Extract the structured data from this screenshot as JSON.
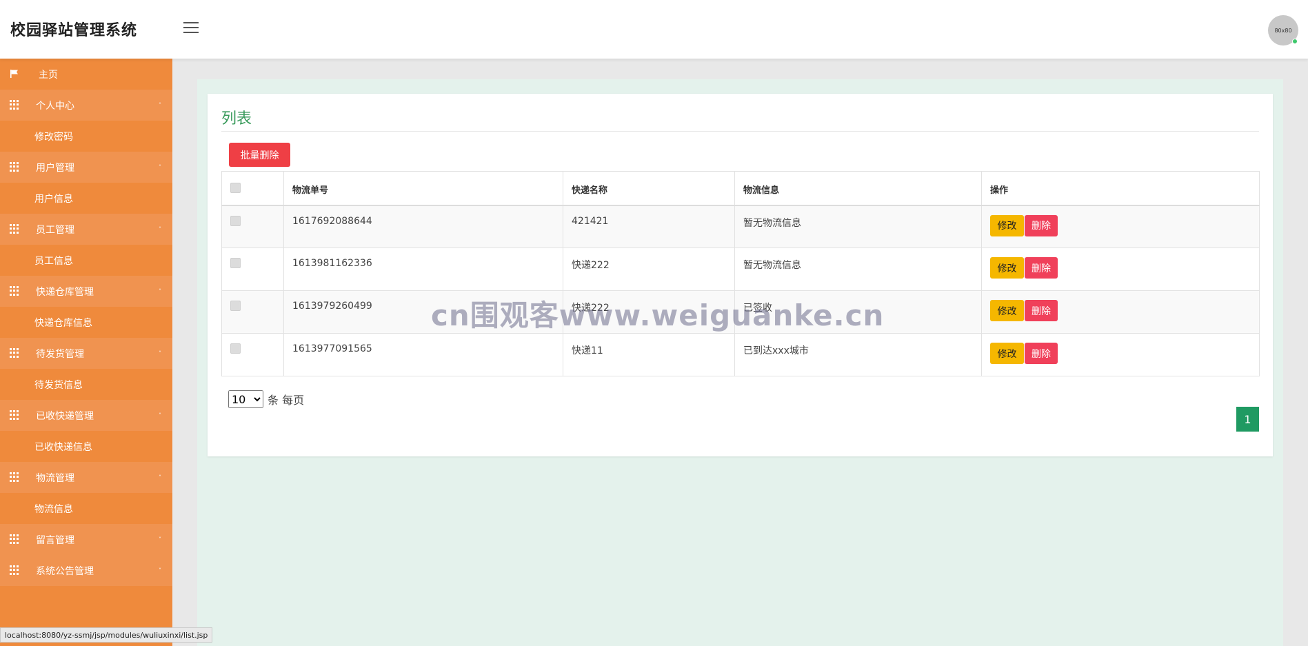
{
  "app": {
    "title": "校园驿站管理系统",
    "avatar_text": "80x80"
  },
  "sidebar": {
    "items": [
      {
        "label": "主页",
        "type": "home",
        "icon": "flag-icon"
      },
      {
        "label": "个人中心",
        "type": "group",
        "caret": "up"
      },
      {
        "label": "修改密码",
        "type": "sub"
      },
      {
        "label": "用户管理",
        "type": "group",
        "caret": "up"
      },
      {
        "label": "用户信息",
        "type": "sub"
      },
      {
        "label": "员工管理",
        "type": "group",
        "caret": "up"
      },
      {
        "label": "员工信息",
        "type": "sub"
      },
      {
        "label": "快递仓库管理",
        "type": "group",
        "caret": "up"
      },
      {
        "label": "快递仓库信息",
        "type": "sub"
      },
      {
        "label": "待发货管理",
        "type": "group",
        "caret": "up"
      },
      {
        "label": "待发货信息",
        "type": "sub"
      },
      {
        "label": "已收快递管理",
        "type": "group",
        "caret": "up"
      },
      {
        "label": "已收快递信息",
        "type": "sub"
      },
      {
        "label": "物流管理",
        "type": "group",
        "caret": "up"
      },
      {
        "label": "物流信息",
        "type": "sub"
      },
      {
        "label": "留言管理",
        "type": "group",
        "caret": "down"
      },
      {
        "label": "系统公告管理",
        "type": "group",
        "caret": "down"
      }
    ]
  },
  "main": {
    "title": "列表",
    "batch_delete_label": "批量删除",
    "table": {
      "headers": [
        "物流单号",
        "快递名称",
        "物流信息",
        "操作"
      ],
      "rows": [
        {
          "order_no": "1617692088644",
          "express_name": "421421",
          "logistics_info": "暂无物流信息"
        },
        {
          "order_no": "1613981162336",
          "express_name": "快递222",
          "logistics_info": "暂无物流信息"
        },
        {
          "order_no": "1613979260499",
          "express_name": "快递222",
          "logistics_info": "已签收"
        },
        {
          "order_no": "1613977091565",
          "express_name": "快递11",
          "logistics_info": "已到达xxx城市"
        }
      ],
      "edit_label": "修改",
      "delete_label": "删除"
    },
    "pagination": {
      "page_size": "10",
      "page_size_suffix": "条 每页",
      "current_page": "1"
    }
  },
  "watermark": "cn围观客www.weiguanke.cn",
  "statusbar": {
    "url": "localhost:8080/yz-ssmj/jsp/modules/wuliuxinxi/list.jsp"
  },
  "colors": {
    "sidebar": "#ef8a3c",
    "title_green": "#3a9b5c",
    "edit_yellow": "#f5b700",
    "delete_red": "#f0405a",
    "page_green": "#1f9a62"
  }
}
